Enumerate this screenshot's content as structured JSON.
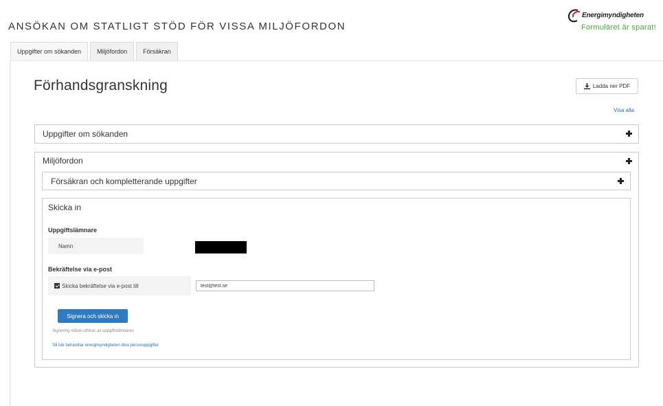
{
  "app": {
    "title": "ANSÖKAN OM STATLIGT STÖD FÖR VISSA MILJÖFORDON",
    "logo_text": "Energimyndigheten",
    "save_status": "Formuläret är sparat!"
  },
  "tabs": [
    {
      "label": "Uppgifter om sökanden"
    },
    {
      "label": "Miljöfordon"
    },
    {
      "label": "Försäkran"
    }
  ],
  "preview": {
    "title": "Förhandsgranskning",
    "download_pdf_label": "Ladda ner PDF",
    "show_all_label": "Visa alla"
  },
  "panels": {
    "applicant": "Uppgifter om sökanden",
    "vehicles": "Miljöfordon",
    "declaration": "Försäkran och kompletterande uppgifter",
    "submit": "Skicka in"
  },
  "submit": {
    "submitter_heading": "Uppgiftslämnare",
    "name_label": "Namn",
    "email_confirm_heading": "Bekräftelse via e-post",
    "email_checkbox_label": "Skicka bekräftelse via e-post till",
    "email_value": "test@test.se",
    "sign_button_label": "Signera och skicka in",
    "sign_hint": "Signering måste utföras av uppgiftslämnaren",
    "privacy_link": "Så här behandlar energimyndigheten dina personuppgifter"
  },
  "colors": {
    "accent_blue": "#2f7bbf",
    "link_blue": "#2a6fa8",
    "saved_green": "#4aa33a",
    "logo_red": "#c8102e"
  },
  "icons": {
    "download": "download-icon",
    "expand": "plus-icon",
    "logo": "energimyndigheten-logo"
  }
}
